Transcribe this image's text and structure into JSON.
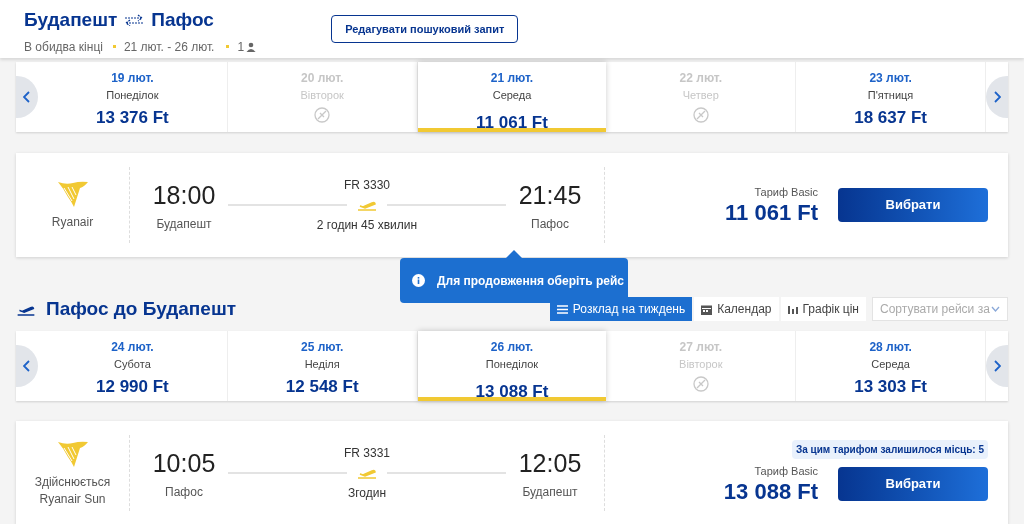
{
  "header": {
    "from": "Будапешт",
    "to": "Пафос",
    "trip_type": "В обидва кінці",
    "dates": "21 лют. - 26 лют.",
    "passengers": "1",
    "edit_button": "Редагувати пошуковий запит"
  },
  "outbound": {
    "days": [
      {
        "date": "19 лют.",
        "weekday": "Понеділок",
        "price": "13 376 Ft",
        "available": true,
        "selected": false
      },
      {
        "date": "20 лют.",
        "weekday": "Вівторок",
        "available": false,
        "selected": false
      },
      {
        "date": "21 лют.",
        "weekday": "Середа",
        "price": "11 061 Ft",
        "available": true,
        "selected": true
      },
      {
        "date": "22 лют.",
        "weekday": "Четвер",
        "available": false,
        "selected": false
      },
      {
        "date": "23 лют.",
        "weekday": "П'ятниця",
        "price": "18 637 Ft",
        "available": true,
        "selected": false
      }
    ],
    "flight": {
      "airline": [
        "Ryanair"
      ],
      "dep_time": "18:00",
      "dep_city": "Будапешт",
      "flight_number": "FR 3330",
      "duration": "2 годин 45 хвилин",
      "arr_time": "21:45",
      "arr_city": "Пафос",
      "fare": "Тариф Basic",
      "price": "11 061 Ft",
      "button": "Вибрати"
    }
  },
  "tooltip": "Для продовження оберіть рейс",
  "return": {
    "heading": "Пафос до Будапешт",
    "view_tabs": [
      {
        "kind": "list",
        "label": "Розклад на тиждень",
        "selected": true
      },
      {
        "kind": "calendar",
        "label": "Календар",
        "selected": false
      },
      {
        "kind": "chart",
        "label": "Графік цін",
        "selected": false
      }
    ],
    "sort_placeholder": "Сортувати рейси за",
    "days": [
      {
        "date": "24 лют.",
        "weekday": "Субота",
        "price": "12 990 Ft",
        "available": true,
        "selected": false
      },
      {
        "date": "25 лют.",
        "weekday": "Неділя",
        "price": "12 548 Ft",
        "available": true,
        "selected": false
      },
      {
        "date": "26 лют.",
        "weekday": "Понеділок",
        "price": "13 088 Ft",
        "available": true,
        "selected": true
      },
      {
        "date": "27 лют.",
        "weekday": "Вівторок",
        "available": false,
        "selected": false
      },
      {
        "date": "28 лют.",
        "weekday": "Середа",
        "price": "13 303 Ft",
        "available": true,
        "selected": false
      }
    ],
    "flight": {
      "airline": [
        "Здійснюється",
        "Ryanair Sun"
      ],
      "dep_time": "10:05",
      "dep_city": "Пафос",
      "flight_number": "FR 3331",
      "duration": "Згодин",
      "arr_time": "12:05",
      "arr_city": "Будапешт",
      "seats_left": "За цим тарифом залишилося місць: 5",
      "fare": "Тариф Basic",
      "price": "13 088 Ft",
      "button": "Вибрати"
    }
  }
}
